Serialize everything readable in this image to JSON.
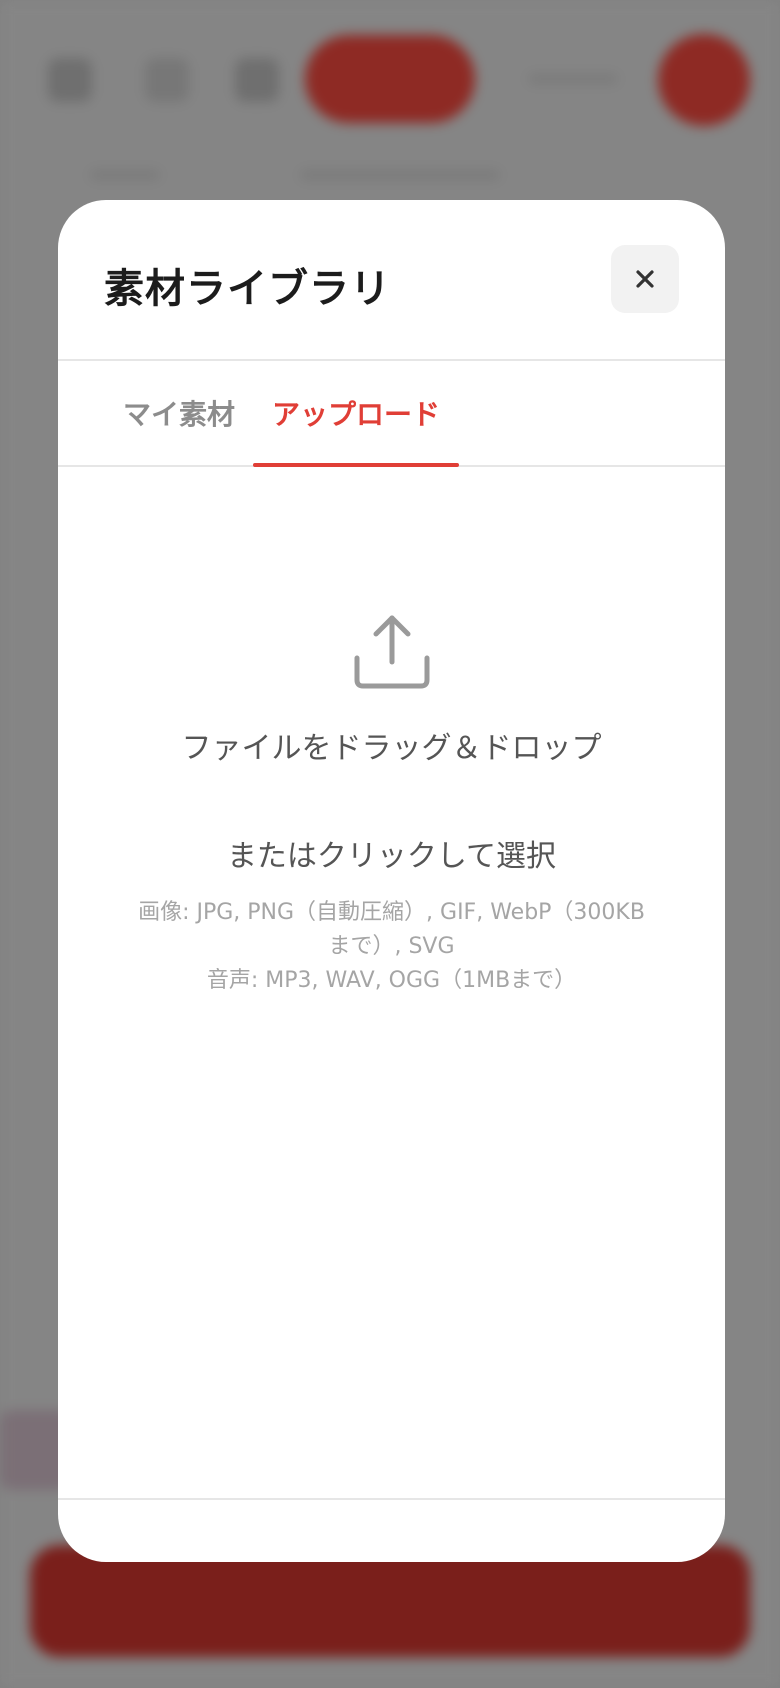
{
  "modal": {
    "title": "素材ライブラリ",
    "close_icon": "close-icon"
  },
  "tabs": [
    {
      "label": "マイ素材",
      "active": false
    },
    {
      "label": "アップロード",
      "active": true
    }
  ],
  "upload": {
    "icon": "upload-icon",
    "drop_text": "ファイルをドラッグ＆ドロップ",
    "click_text": "またはクリックして選択",
    "formats_images": "画像: JPG, PNG（自動圧縮）, GIF, WebP（300KBまで）, SVG",
    "formats_audio": "音声: MP3, WAV, OGG（1MBまで）"
  },
  "colors": {
    "accent": "#e03e36",
    "inactive_tab": "#8c8c8c",
    "overlay": "#808080"
  }
}
